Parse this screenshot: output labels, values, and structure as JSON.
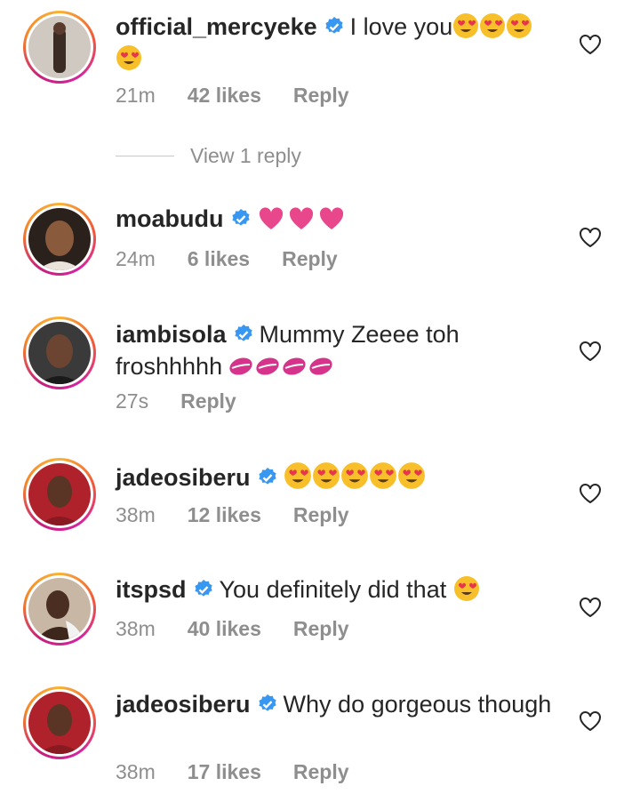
{
  "comments": [
    {
      "username": "official_mercyeke",
      "text": "I love you",
      "emoji": [
        "heart-eyes",
        "heart-eyes",
        "heart-eyes",
        "heart-eyes"
      ],
      "time": "21m",
      "likes": "42 likes",
      "reply": "Reply"
    },
    {
      "username": "moabudu",
      "text": "",
      "emoji": [
        "pink-heart",
        "pink-heart",
        "pink-heart"
      ],
      "time": "24m",
      "likes": "6 likes",
      "reply": "Reply"
    },
    {
      "username": "iambisola",
      "text": "Mummy Zeeee toh froshhhhh",
      "emoji": [
        "kiss-lips",
        "kiss-lips",
        "kiss-lips",
        "kiss-lips"
      ],
      "time": "27s",
      "likes": "",
      "reply": "Reply"
    },
    {
      "username": "jadeosiberu",
      "text": "",
      "emoji": [
        "heart-eyes",
        "heart-eyes",
        "heart-eyes",
        "heart-eyes",
        "heart-eyes"
      ],
      "time": "38m",
      "likes": "12 likes",
      "reply": "Reply"
    },
    {
      "username": "itspsd",
      "text": "You definitely did that",
      "emoji": [
        "heart-eyes"
      ],
      "time": "38m",
      "likes": "40 likes",
      "reply": "Reply"
    },
    {
      "username": "jadeosiberu",
      "text": "Why do gorgeous though",
      "emoji": [],
      "time": "38m",
      "likes": "17 likes",
      "reply": "Reply"
    }
  ],
  "view_replies": "View 1 reply",
  "icons": {
    "verified": "verified-badge-icon",
    "like": "heart-outline-icon"
  },
  "colors": {
    "verified": "#3897f0",
    "muted": "#8e8e8e",
    "text": "#262626",
    "pink": "#e8488b",
    "emoji_face": "#f7c02a",
    "emoji_heart": "#e8354f"
  }
}
